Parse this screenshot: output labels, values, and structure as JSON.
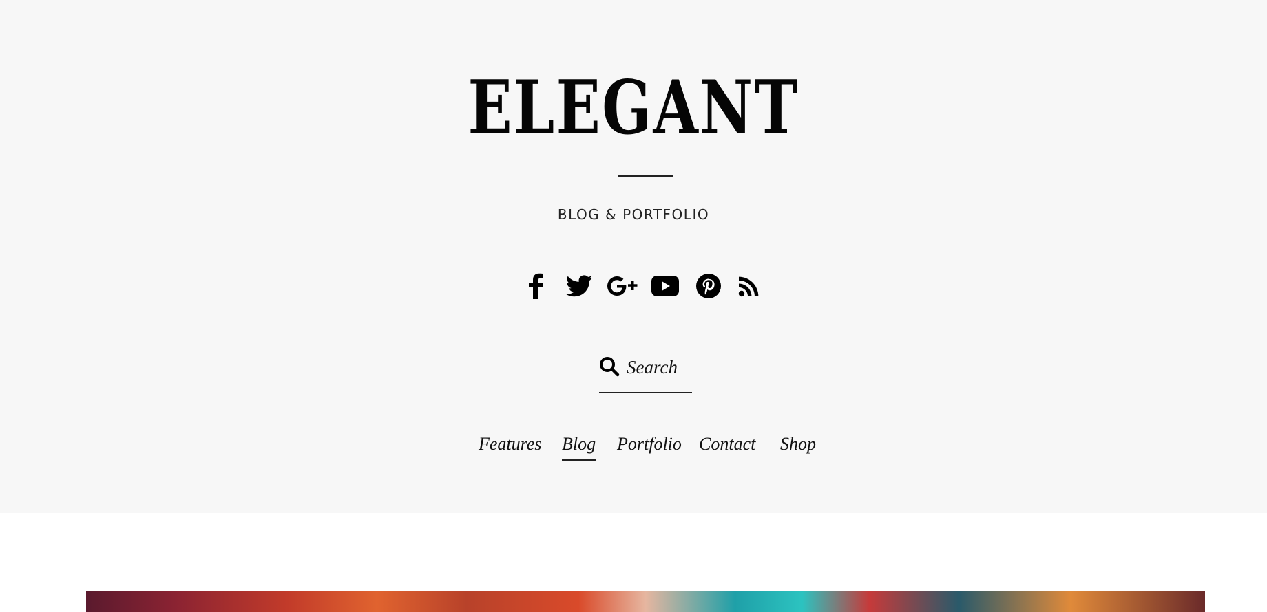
{
  "site": {
    "title": "ELEGANT",
    "tagline": "BLOG & PORTFOLIO"
  },
  "social": [
    {
      "name": "facebook-icon"
    },
    {
      "name": "twitter-icon"
    },
    {
      "name": "google-plus-icon"
    },
    {
      "name": "youtube-icon"
    },
    {
      "name": "pinterest-icon"
    },
    {
      "name": "rss-icon"
    }
  ],
  "search": {
    "placeholder": "Search",
    "icon": "search-icon"
  },
  "nav": {
    "items": [
      {
        "label": "Features"
      },
      {
        "label": "Blog",
        "active": true
      },
      {
        "label": "Portfolio"
      },
      {
        "label": "Contact"
      },
      {
        "label": "Shop"
      }
    ]
  },
  "colors": {
    "header_bg": "#f7f7f7",
    "text": "#111111"
  }
}
